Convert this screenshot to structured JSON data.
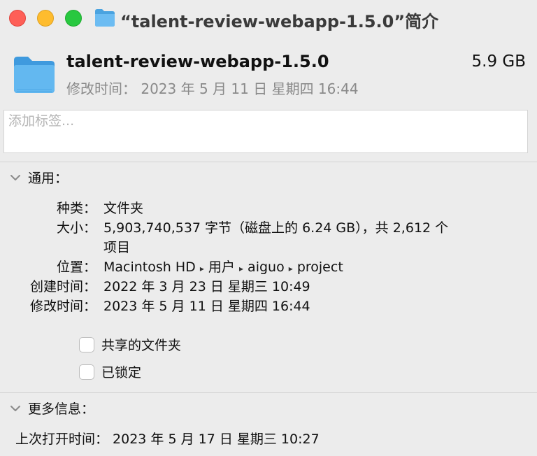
{
  "window": {
    "title": "“talent-review-webapp-1.5.0”简介"
  },
  "header": {
    "file_name": "talent-review-webapp-1.5.0",
    "file_size": "5.9 GB",
    "modified": "修改时间： 2023 年 5 月 11 日 星期四 16:44"
  },
  "tags": {
    "placeholder": "添加标签..."
  },
  "general": {
    "section_label": "通用：",
    "kind_label": "种类：",
    "kind_value": "文件夹",
    "size_label": "大小：",
    "size_value_line1": "5,903,740,537 字节（磁盘上的 6.24 GB），共 2,612 个",
    "size_value_line2": "项目",
    "where_label": "位置：",
    "where_path": [
      "Macintosh HD",
      "用户",
      "aiguo",
      "project"
    ],
    "created_label": "创建时间：",
    "created_value": "2022 年 3 月 23 日 星期三 10:49",
    "modified_label": "修改时间：",
    "modified_value": "2023 年 5 月 11 日 星期四 16:44",
    "shared_folder_label": "共享的文件夹",
    "locked_label": "已锁定"
  },
  "more_info": {
    "section_label": "更多信息：",
    "last_opened": "上次打开时间： 2023 年 5 月 17 日 星期三 10:27"
  },
  "icons": {
    "folder": "folder-icon",
    "chevron": "chevron-down-icon",
    "path_separator": "▸"
  },
  "colors": {
    "close": "#fe5f57",
    "minimize": "#febc2e",
    "maximize": "#28c840",
    "folder": "#5ab3ee"
  }
}
